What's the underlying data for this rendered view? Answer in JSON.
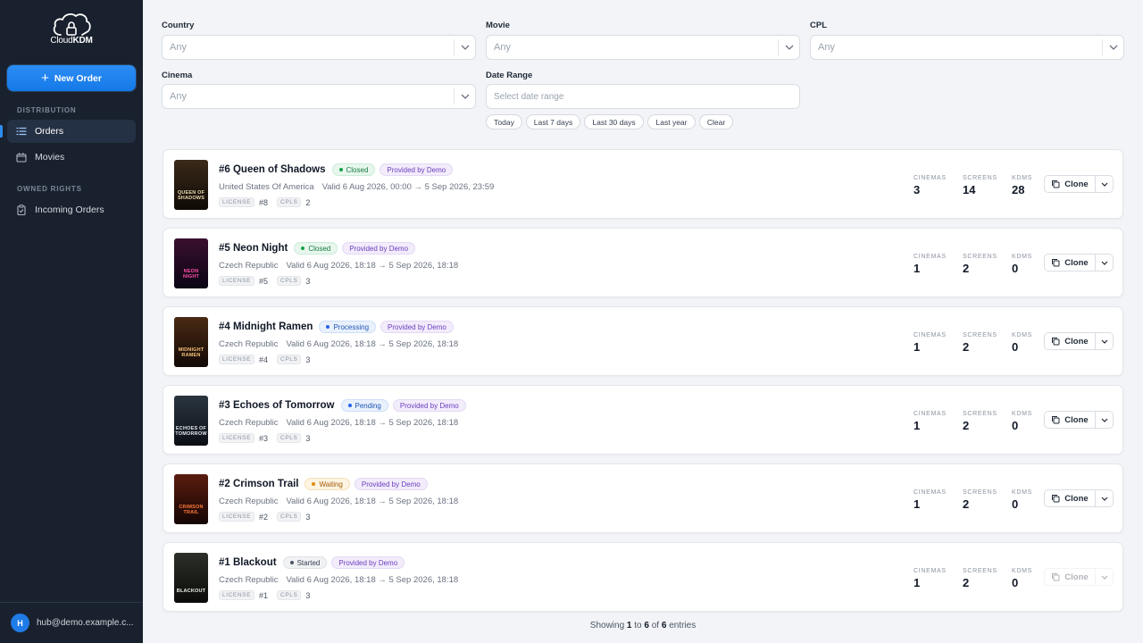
{
  "app": {
    "logo_prefix": "Cloud",
    "logo_suffix": "KDM"
  },
  "sidebar": {
    "new_order_label": "New Order",
    "section_distribution": "DISTRIBUTION",
    "section_owned": "OWNED RIGHTS",
    "items": [
      {
        "label": "Orders",
        "icon": "list-icon",
        "active": true
      },
      {
        "label": "Movies",
        "icon": "film-icon",
        "active": false
      },
      {
        "label": "Incoming Orders",
        "icon": "clipboard-icon",
        "active": false
      }
    ],
    "user": {
      "initial": "H",
      "email": "hub@demo.example.c..."
    }
  },
  "filters": {
    "country": {
      "label": "Country",
      "value": "Any"
    },
    "movie": {
      "label": "Movie",
      "value": "Any"
    },
    "cpl": {
      "label": "CPL",
      "value": "Any"
    },
    "cinema": {
      "label": "Cinema",
      "value": "Any"
    },
    "date_range": {
      "label": "Date Range",
      "placeholder": "Select date range"
    },
    "quick": [
      "Today",
      "Last 7 days",
      "Last 30 days",
      "Last year",
      "Clear"
    ]
  },
  "stat_labels": {
    "cinemas": "CINEMAS",
    "screens": "SCREENS",
    "kdms": "KDMS"
  },
  "tag_labels": {
    "license": "LICENSE",
    "cpls": "CPLS"
  },
  "clone_label": "Clone",
  "orders": [
    {
      "title": "#6 Queen of Shadows",
      "status": "Closed",
      "provider": "Provided by Demo",
      "country": "United States Of America",
      "valid": "Valid 6 Aug 2026, 00:00 → 5 Sep 2026, 23:59",
      "license": "#8",
      "cpls": "2",
      "cinemas": "3",
      "screens": "14",
      "kdms": "28",
      "poster_text": "QUEEN OF SHADOWS"
    },
    {
      "title": "#5 Neon Night",
      "status": "Closed",
      "provider": "Provided by Demo",
      "country": "Czech Republic",
      "valid": "Valid 6 Aug 2026, 18:18 → 5 Sep 2026, 18:18",
      "license": "#5",
      "cpls": "3",
      "cinemas": "1",
      "screens": "2",
      "kdms": "0",
      "poster_text": "NEON NIGHT"
    },
    {
      "title": "#4 Midnight Ramen",
      "status": "Processing",
      "provider": "Provided by Demo",
      "country": "Czech Republic",
      "valid": "Valid 6 Aug 2026, 18:18 → 5 Sep 2026, 18:18",
      "license": "#4",
      "cpls": "3",
      "cinemas": "1",
      "screens": "2",
      "kdms": "0",
      "poster_text": "MIDNIGHT RAMEN"
    },
    {
      "title": "#3 Echoes of Tomorrow",
      "status": "Pending",
      "provider": "Provided by Demo",
      "country": "Czech Republic",
      "valid": "Valid 6 Aug 2026, 18:18 → 5 Sep 2026, 18:18",
      "license": "#3",
      "cpls": "3",
      "cinemas": "1",
      "screens": "2",
      "kdms": "0",
      "poster_text": "ECHOES OF TOMORROW"
    },
    {
      "title": "#2 Crimson Trail",
      "status": "Waiting",
      "provider": "Provided by Demo",
      "country": "Czech Republic",
      "valid": "Valid 6 Aug 2026, 18:18 → 5 Sep 2026, 18:18",
      "license": "#2",
      "cpls": "3",
      "cinemas": "1",
      "screens": "2",
      "kdms": "0",
      "poster_text": "CRIMSON TRAIL"
    },
    {
      "title": "#1 Blackout",
      "status": "Started",
      "provider": "Provided by Demo",
      "country": "Czech Republic",
      "valid": "Valid 6 Aug 2026, 18:18 → 5 Sep 2026, 18:18",
      "license": "#1",
      "cpls": "3",
      "cinemas": "1",
      "screens": "2",
      "kdms": "0",
      "poster_text": "BLACKOUT"
    }
  ],
  "footer": {
    "prefix": "Showing",
    "from": "1",
    "to_word": "to",
    "to": "6",
    "of_word": "of",
    "total": "6",
    "suffix": "entries"
  },
  "colors": {
    "accent": "#1f7be6",
    "sidebar_bg": "#19212e",
    "page_bg": "#f2f4f7"
  }
}
